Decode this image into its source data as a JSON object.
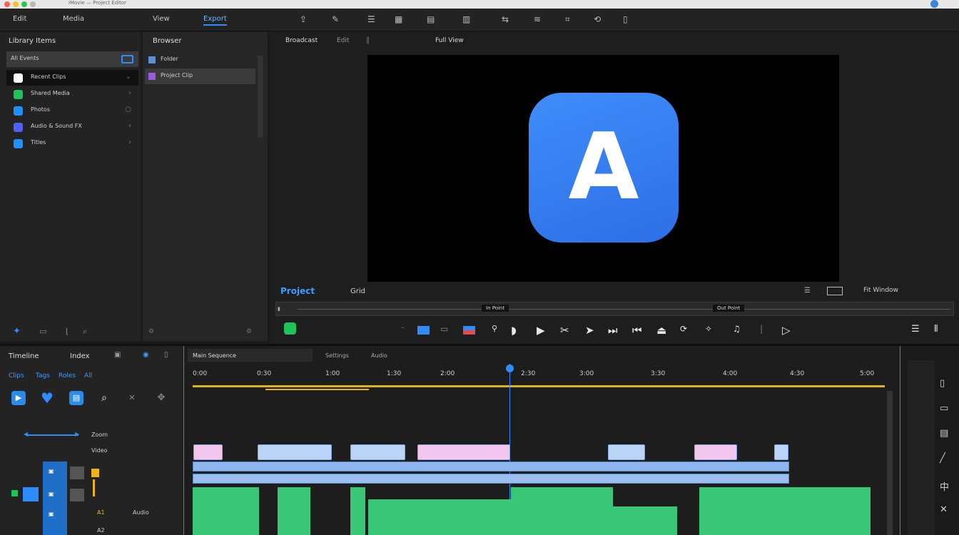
{
  "window": {
    "title": "iMovie — Project Editor"
  },
  "menu": {
    "items": [
      "Edit",
      "Media",
      "View",
      "Export"
    ],
    "active_index": 2
  },
  "library": {
    "title": "Library Items",
    "selected": "All Events",
    "items": [
      {
        "label": "Recent Clips",
        "icon_color": "#ffffff"
      },
      {
        "label": "Shared Media",
        "icon_color": "#22c25a"
      },
      {
        "label": "Photos",
        "icon_color": "#1e90ff"
      },
      {
        "label": "Audio & Sound FX",
        "icon_color": "#5060ff"
      },
      {
        "label": "Titles",
        "icon_color": "#1e90ff"
      }
    ]
  },
  "browser": {
    "title": "Browser",
    "items": [
      "Folder",
      "Project Clip"
    ]
  },
  "viewer": {
    "tabs": [
      "Broadcast",
      "Edit",
      "Full View"
    ],
    "logo_letter": "A",
    "project_label": "Project",
    "clip_label": "Grid",
    "fit_label": "Fit Window",
    "marker_in": "In Point",
    "marker_out": "Out Point"
  },
  "timeline": {
    "title": "Timeline",
    "tab": "Index",
    "subtabs": [
      "Clips",
      "Tags",
      "Roles",
      "All"
    ],
    "sequence_name": "Main Sequence",
    "sequence_tab": "Settings",
    "sequence_tab2": "Audio",
    "time_labels": [
      "0:00",
      "0:30",
      "1:00",
      "1:30",
      "2:00",
      "2:30",
      "3:00",
      "3:30",
      "4:00",
      "4:30",
      "5:00"
    ],
    "range_label": "Zoom",
    "track_label": "Video",
    "track_label2": "Audio",
    "badge_a": "A1",
    "badge_b": "A2"
  }
}
